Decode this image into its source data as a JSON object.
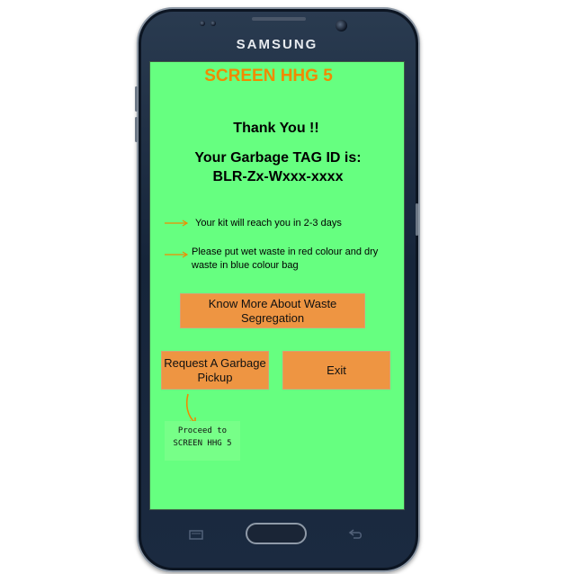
{
  "device": {
    "brand": "SAMSUNG"
  },
  "screen": {
    "title": "SCREEN HHG 5",
    "thanks": "Thank You !!",
    "tag_label": "Your Garbage TAG ID is:",
    "tag_value": "BLR-Zx-Wxxx-xxxx",
    "notes": [
      "Your kit will reach you in 2-3 days",
      "Please put wet waste in red colour and dry waste in blue colour bag"
    ],
    "buttons": {
      "know_more": "Know More About Waste Segregation",
      "request_pickup": "Request A Garbage Pickup",
      "exit": "Exit"
    },
    "annotation": {
      "line1": "Proceed to",
      "line2": "SCREEN HHG 5"
    }
  },
  "colors": {
    "screen_bg": "#66ff80",
    "title": "#f08a00",
    "button": "#ee9542",
    "arrow": "#f08a00"
  },
  "icons": {
    "recent_apps": "recent-apps-icon",
    "back": "back-icon"
  }
}
